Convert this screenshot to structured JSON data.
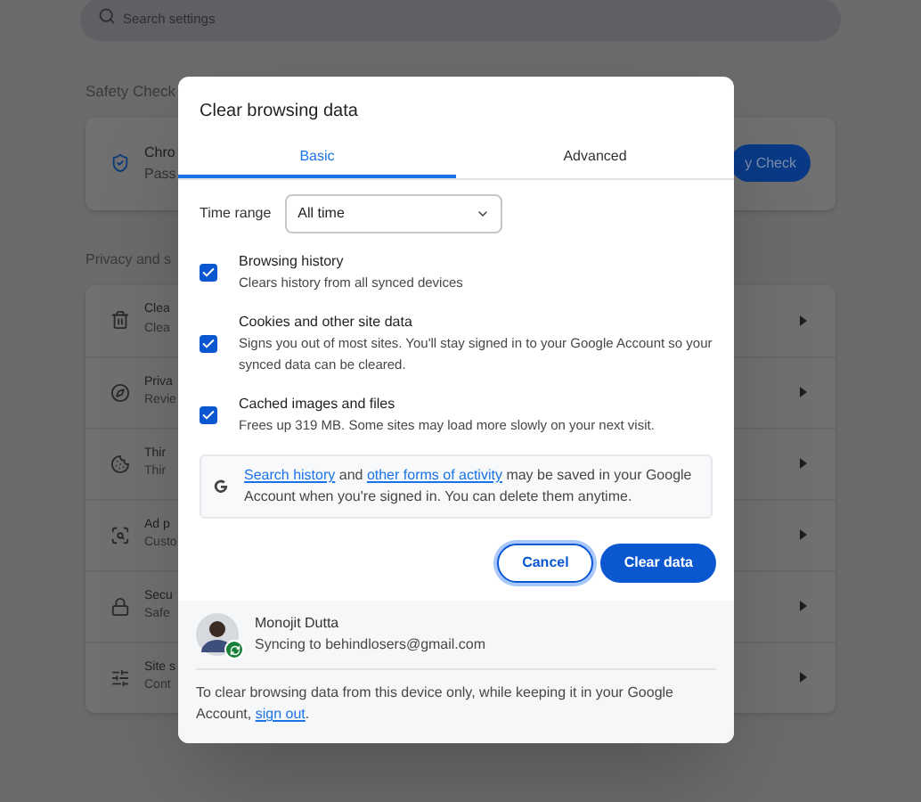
{
  "search": {
    "placeholder": "Search settings"
  },
  "safety_check": {
    "heading": "Safety Check",
    "title": "Chro",
    "subtitle": "Pass",
    "button": "y Check"
  },
  "privacy": {
    "heading": "Privacy and s",
    "rows": [
      {
        "title": "Clea",
        "subtitle": "Clea"
      },
      {
        "title": "Priva",
        "subtitle": "Revie"
      },
      {
        "title": "Thir",
        "subtitle": "Thir"
      },
      {
        "title": "Ad p",
        "subtitle": "Custo"
      },
      {
        "title": "Secu",
        "subtitle": "Safe"
      },
      {
        "title": "Site s",
        "subtitle": "Cont"
      }
    ]
  },
  "dialog": {
    "title": "Clear browsing data",
    "tabs": [
      {
        "label": "Basic",
        "selected": true
      },
      {
        "label": "Advanced",
        "selected": false
      }
    ],
    "time_range": {
      "label": "Time range",
      "value": "All time"
    },
    "options": [
      {
        "title": "Browsing history",
        "description": "Clears history from all synced devices",
        "checked": true
      },
      {
        "title": "Cookies and other site data",
        "description": "Signs you out of most sites. You'll stay signed in to your Google Account so your synced data can be cleared.",
        "checked": true
      },
      {
        "title": "Cached images and files",
        "description": "Frees up 319 MB. Some sites may load more slowly on your next visit.",
        "checked": true
      }
    ],
    "notice": [
      {
        "kind": "link",
        "text": "Search history"
      },
      {
        "kind": "text",
        "text": " and "
      },
      {
        "kind": "link",
        "text": "other forms of activity"
      },
      {
        "kind": "text",
        "text": " may be saved in your Google Account when you're signed in. You can delete them anytime."
      }
    ],
    "buttons": [
      {
        "label": "Cancel",
        "kind": "outline"
      },
      {
        "label": "Clear data",
        "kind": "primary"
      }
    ],
    "account": {
      "name": "Monojit Dutta",
      "status": "Syncing to behindlosers@gmail.com"
    },
    "footer": [
      {
        "kind": "text",
        "text": "To clear browsing data from this device only, while keeping it in your Google Account, "
      },
      {
        "kind": "link",
        "text": "sign out"
      },
      {
        "kind": "text",
        "text": "."
      }
    ]
  }
}
